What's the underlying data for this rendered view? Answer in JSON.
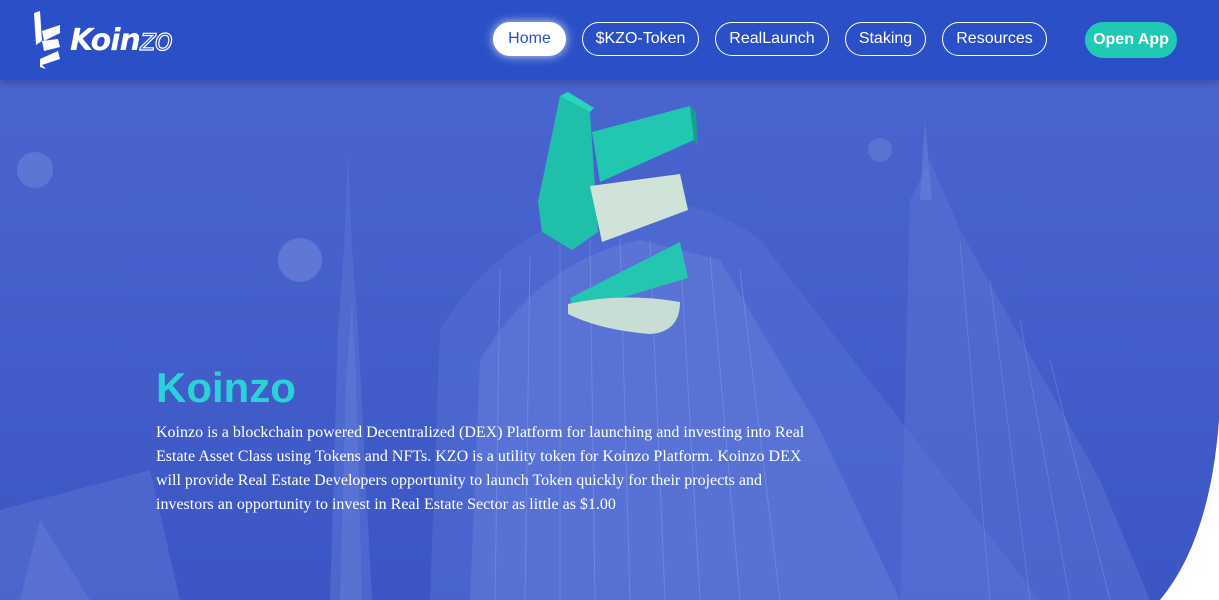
{
  "brand": {
    "logo_part1": "Koin",
    "logo_part2": "zo"
  },
  "nav": {
    "items": [
      {
        "label": "Home",
        "active": true
      },
      {
        "label": "$KZO-Token",
        "active": false
      },
      {
        "label": "RealLaunch",
        "active": false
      },
      {
        "label": "Staking",
        "active": false
      },
      {
        "label": "Resources",
        "active": false
      }
    ],
    "cta_label": "Open App"
  },
  "hero": {
    "title": "Koinzo",
    "description": "Koinzo is a blockchain powered Decentralized (DEX) Platform for launching and investing into Real Estate Asset Class using Tokens and NFTs. KZO is a utility token for Koinzo Platform. Koinzo DEX will provide Real Estate Developers opportunity to launch Token quickly for their projects and investors an opportunity to invest in Real Estate Sector as little as $1.00"
  },
  "colors": {
    "nav_bg": "#2b4fc7",
    "accent_teal": "#20c9b3",
    "title_cyan": "#2ad1d6",
    "hero_bg": "#4661cc"
  },
  "icons": {
    "brand_logo": "koinzo-k-logo-icon",
    "hero_logo": "koinzo-3d-k-icon"
  }
}
